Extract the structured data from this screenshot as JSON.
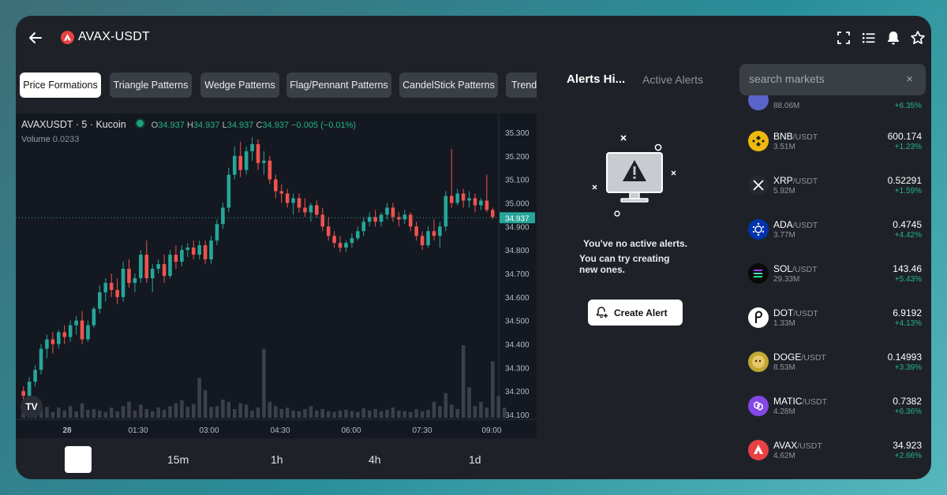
{
  "header": {
    "pair": "AVAX-USDT",
    "icons": [
      "fullscreen-icon",
      "list-icon",
      "bell-icon",
      "star-icon"
    ]
  },
  "pattern_tabs": [
    {
      "label": "Price Formations",
      "active": true
    },
    {
      "label": "Triangle Patterns",
      "active": false
    },
    {
      "label": "Wedge Patterns",
      "active": false
    },
    {
      "label": "Flag/Pennant Patterns",
      "active": false
    },
    {
      "label": "CandelStick Patterns",
      "active": false
    },
    {
      "label": "Trendl",
      "active": false
    }
  ],
  "chart": {
    "symbol": "AVAXUSDT · 5 · Kucoin",
    "o_label": "O",
    "o": "34.937",
    "h_label": "H",
    "h": "34.937",
    "l_label": "L",
    "l": "34.937",
    "c_label": "C",
    "c": "34.937",
    "change": "−0.005 (−0.01%)",
    "volume_label": "Volume",
    "volume": "0.0233",
    "current_price": "34.937",
    "logo": "TV",
    "colors": {
      "up": "#26a69a",
      "down": "#ef5350",
      "volume": "#3c4049",
      "bg": "#141820"
    }
  },
  "chart_data": {
    "type": "candlestick",
    "y_ticks": [
      "35.300",
      "35.200",
      "35.100",
      "35.000",
      "34.900",
      "34.800",
      "34.700",
      "34.600",
      "34.500",
      "34.400",
      "34.300",
      "34.200",
      "34.100"
    ],
    "ylim": [
      34.08,
      35.34
    ],
    "x_ticks": [
      "28",
      "01:30",
      "03:00",
      "04:30",
      "06:00",
      "07:30",
      "09:00"
    ],
    "last_price": 34.937,
    "candles": [
      [
        34.2,
        34.22,
        34.16,
        34.18
      ],
      [
        34.18,
        34.26,
        34.17,
        34.24
      ],
      [
        34.24,
        34.31,
        34.22,
        34.29
      ],
      [
        34.29,
        34.4,
        34.27,
        34.38
      ],
      [
        34.38,
        34.44,
        34.34,
        34.42
      ],
      [
        34.42,
        34.45,
        34.36,
        34.4
      ],
      [
        34.4,
        34.46,
        34.38,
        34.45
      ],
      [
        34.45,
        34.48,
        34.4,
        34.43
      ],
      [
        34.43,
        34.5,
        34.41,
        34.48
      ],
      [
        34.48,
        34.52,
        34.44,
        34.5
      ],
      [
        34.5,
        34.54,
        34.4,
        34.42
      ],
      [
        34.42,
        34.5,
        34.41,
        34.48
      ],
      [
        34.48,
        34.56,
        34.47,
        34.55
      ],
      [
        34.55,
        34.65,
        34.53,
        34.62
      ],
      [
        34.62,
        34.68,
        34.58,
        34.66
      ],
      [
        34.66,
        34.7,
        34.6,
        34.63
      ],
      [
        34.63,
        34.68,
        34.57,
        34.6
      ],
      [
        34.6,
        34.75,
        34.58,
        34.72
      ],
      [
        34.72,
        34.76,
        34.64,
        34.66
      ],
      [
        34.66,
        34.7,
        34.62,
        34.68
      ],
      [
        34.68,
        34.8,
        34.66,
        34.78
      ],
      [
        34.78,
        34.84,
        34.66,
        34.68
      ],
      [
        34.68,
        34.74,
        34.62,
        34.72
      ],
      [
        34.72,
        34.76,
        34.7,
        34.74
      ],
      [
        34.74,
        34.78,
        34.66,
        34.69
      ],
      [
        34.69,
        34.8,
        34.68,
        34.78
      ],
      [
        34.78,
        34.82,
        34.72,
        34.75
      ],
      [
        34.75,
        34.82,
        34.73,
        34.8
      ],
      [
        34.8,
        34.83,
        34.77,
        34.81
      ],
      [
        34.81,
        34.84,
        34.76,
        34.78
      ],
      [
        34.78,
        34.84,
        34.76,
        34.82
      ],
      [
        34.82,
        34.84,
        34.74,
        34.76
      ],
      [
        34.76,
        34.86,
        34.74,
        34.84
      ],
      [
        34.84,
        34.93,
        34.82,
        34.91
      ],
      [
        34.91,
        35.0,
        34.89,
        34.98
      ],
      [
        34.98,
        35.15,
        34.96,
        35.12
      ],
      [
        35.12,
        35.24,
        35.1,
        35.2
      ],
      [
        35.2,
        35.26,
        35.11,
        35.14
      ],
      [
        35.14,
        35.24,
        35.12,
        35.22
      ],
      [
        35.22,
        35.28,
        35.18,
        35.25
      ],
      [
        35.25,
        35.27,
        35.14,
        35.17
      ],
      [
        35.17,
        35.22,
        35.12,
        35.18
      ],
      [
        35.18,
        35.2,
        35.08,
        35.1
      ],
      [
        35.1,
        35.12,
        35.02,
        35.05
      ],
      [
        35.05,
        35.08,
        35.0,
        35.04
      ],
      [
        35.04,
        35.06,
        34.98,
        35.0
      ],
      [
        35.0,
        35.04,
        34.95,
        35.02
      ],
      [
        35.02,
        35.04,
        34.96,
        34.98
      ],
      [
        34.98,
        35.02,
        34.94,
        34.96
      ],
      [
        34.96,
        35.0,
        34.92,
        34.99
      ],
      [
        34.99,
        35.01,
        34.94,
        34.95
      ],
      [
        34.95,
        34.98,
        34.88,
        34.9
      ],
      [
        34.9,
        34.94,
        34.84,
        34.86
      ],
      [
        34.86,
        34.88,
        34.81,
        34.83
      ],
      [
        34.83,
        34.86,
        34.79,
        34.81
      ],
      [
        34.81,
        34.84,
        34.79,
        34.83
      ],
      [
        34.83,
        34.87,
        34.81,
        34.85
      ],
      [
        34.85,
        34.9,
        34.84,
        34.88
      ],
      [
        34.88,
        34.94,
        34.86,
        34.92
      ],
      [
        34.92,
        34.96,
        34.9,
        34.94
      ],
      [
        34.94,
        34.97,
        34.9,
        34.92
      ],
      [
        34.92,
        34.96,
        34.9,
        34.95
      ],
      [
        34.95,
        35.0,
        34.93,
        34.98
      ],
      [
        34.98,
        35.0,
        34.92,
        34.94
      ],
      [
        34.94,
        34.96,
        34.9,
        34.93
      ],
      [
        34.93,
        34.97,
        34.91,
        34.95
      ],
      [
        34.95,
        34.96,
        34.88,
        34.9
      ],
      [
        34.9,
        34.92,
        34.84,
        34.86
      ],
      [
        34.86,
        34.88,
        34.8,
        34.82
      ],
      [
        34.82,
        34.9,
        34.81,
        34.88
      ],
      [
        34.88,
        34.93,
        34.84,
        34.86
      ],
      [
        34.86,
        34.92,
        34.81,
        34.9
      ],
      [
        34.9,
        35.05,
        34.88,
        35.03
      ],
      [
        35.03,
        35.23,
        34.98,
        35.0
      ],
      [
        35.0,
        35.06,
        34.99,
        35.04
      ],
      [
        35.04,
        35.06,
        34.98,
        35.01
      ],
      [
        35.01,
        35.05,
        34.98,
        35.02
      ],
      [
        35.02,
        35.04,
        34.96,
        34.99
      ],
      [
        34.99,
        35.02,
        34.97,
        35.01
      ],
      [
        35.01,
        35.12,
        34.96,
        34.97
      ],
      [
        34.97,
        34.98,
        34.93,
        34.94
      ]
    ],
    "volumes": [
      18,
      30,
      22,
      12,
      15,
      8,
      14,
      10,
      16,
      9,
      20,
      11,
      12,
      10,
      8,
      14,
      9,
      16,
      22,
      10,
      18,
      12,
      9,
      14,
      11,
      16,
      20,
      24,
      15,
      19,
      55,
      38,
      15,
      16,
      25,
      22,
      12,
      20,
      18,
      10,
      14,
      95,
      22,
      16,
      12,
      14,
      10,
      9,
      12,
      16,
      10,
      12,
      9,
      8,
      10,
      11,
      9,
      8,
      13,
      10,
      12,
      9,
      11,
      14,
      10,
      9,
      8,
      12,
      9,
      11,
      22,
      16,
      34,
      18,
      12,
      100,
      42,
      16,
      22,
      14,
      78,
      30,
      14
    ]
  },
  "timeframes": {
    "selected": "",
    "options": [
      "15m",
      "1h",
      "4h",
      "1d"
    ]
  },
  "alerts": {
    "tab_history": "Alerts Hi...",
    "tab_active": "Active Alerts",
    "empty_line1": "You've no active alerts.",
    "empty_line2": "You can try creating new ones.",
    "create_label": "Create Alert"
  },
  "search": {
    "placeholder": "search markets",
    "clear": "×"
  },
  "markets": [
    {
      "base": "",
      "quote": "",
      "volume": "88.06M",
      "price": "",
      "change": "+6.35%",
      "color": "#5a63c9",
      "icon": "partial-coin-icon"
    },
    {
      "base": "BNB",
      "quote": "/USDT",
      "volume": "3.51M",
      "price": "600.174",
      "change": "+1.23%",
      "color": "#f0b90b",
      "icon": "bnb-icon"
    },
    {
      "base": "XRP",
      "quote": "/USDT",
      "volume": "5.92M",
      "price": "0.52291",
      "change": "+1.59%",
      "color": "#23292f",
      "icon": "xrp-icon"
    },
    {
      "base": "ADA",
      "quote": "/USDT",
      "volume": "3.77M",
      "price": "0.4745",
      "change": "+4.42%",
      "color": "#0033ad",
      "icon": "ada-icon"
    },
    {
      "base": "SOL",
      "quote": "/USDT",
      "volume": "29.33M",
      "price": "143.46",
      "change": "+5.43%",
      "color": "#0a0a0a",
      "icon": "sol-icon"
    },
    {
      "base": "DOT",
      "quote": "/USDT",
      "volume": "1.33M",
      "price": "6.9192",
      "change": "+4.13%",
      "color": "#ffffff",
      "icon": "dot-icon"
    },
    {
      "base": "DOGE",
      "quote": "/USDT",
      "volume": "8.53M",
      "price": "0.14993",
      "change": "+3.39%",
      "color": "#c2a633",
      "icon": "doge-icon"
    },
    {
      "base": "MATIC",
      "quote": "/USDT",
      "volume": "4.28M",
      "price": "0.7382",
      "change": "+6.36%",
      "color": "#8247e5",
      "icon": "matic-icon"
    },
    {
      "base": "AVAX",
      "quote": "/USDT",
      "volume": "4.62M",
      "price": "34.923",
      "change": "+2.66%",
      "color": "#e84142",
      "icon": "avax-icon"
    }
  ]
}
